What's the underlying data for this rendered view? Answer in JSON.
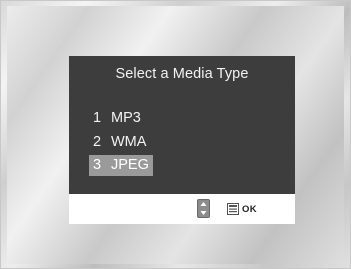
{
  "dialog": {
    "title": "Select a Media Type",
    "items": [
      {
        "number": "1",
        "label": "MP3",
        "selected": false
      },
      {
        "number": "2",
        "label": "WMA",
        "selected": false
      },
      {
        "number": "3",
        "label": "JPEG",
        "selected": true
      }
    ]
  },
  "footer": {
    "ok_label": "OK",
    "updown_icon": "up-down-arrows-icon",
    "enter_icon": "enter-key-icon"
  },
  "colors": {
    "panel": "#3d3d3d",
    "highlight": "#9a9a9a",
    "footer": "#ffffff"
  }
}
